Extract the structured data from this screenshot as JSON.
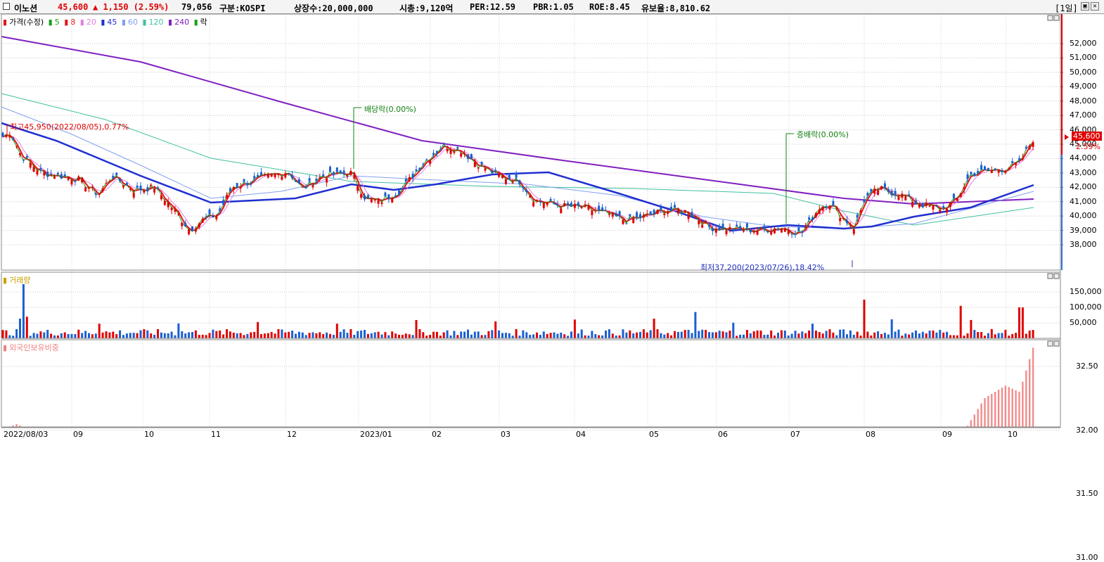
{
  "header": {
    "stock_name": "이노션",
    "price": "45,600",
    "change": "▲ 1,150 (2.59%)",
    "volume": "79,056",
    "market": "구분:KOSPI",
    "shares": "상장수:20,000,000",
    "market_cap": "시총:9,120억",
    "per": "PER:12.59",
    "pbr": "PBR:1.05",
    "roe": "ROE:8.45",
    "float": "유보율:8,810.62",
    "period": "[1일]",
    "colors": {
      "up": "#e00000",
      "down": "#1a5fd0"
    }
  },
  "price_panel": {
    "legend": {
      "price_label": "가격(수정)",
      "ma": [
        "5",
        "8",
        "20",
        "45",
        "60",
        "120",
        "240"
      ],
      "ma_colors": [
        "#1aa01a",
        "#e01818",
        "#e080e0",
        "#1f2fd0",
        "#80a0f0",
        "#40c0a0",
        "#8020c0"
      ],
      "ex_label": "락"
    },
    "annotations": {
      "high": "최고45,950(2022/08/05),0.77%",
      "low": "최저37,200(2023/07/26),18.42%",
      "dividend": "배당락(0.00%)",
      "bonus": "증배락(0.00%)"
    },
    "current_price_tag": "45,600",
    "current_change_tag": "2.59%",
    "y_ticks": [
      "52,000",
      "51,000",
      "50,000",
      "49,000",
      "48,000",
      "47,000",
      "46,000",
      "45,000",
      "44,000",
      "43,000",
      "42,000",
      "41,000",
      "40,000",
      "39,000",
      "38,000"
    ]
  },
  "volume_panel": {
    "label": "거래량",
    "y_ticks": [
      "150,000",
      "100,000",
      "50,000"
    ]
  },
  "foreign_panel": {
    "label": "외국인보유비중",
    "y_ticks": [
      "32.50",
      "32.00",
      "31.50",
      "31.00"
    ]
  },
  "x_axis": {
    "labels": [
      "2022/08/03",
      "09",
      "10",
      "11",
      "12",
      "2023/01",
      "02",
      "03",
      "04",
      "05",
      "06",
      "07",
      "08",
      "09",
      "10"
    ]
  }
}
